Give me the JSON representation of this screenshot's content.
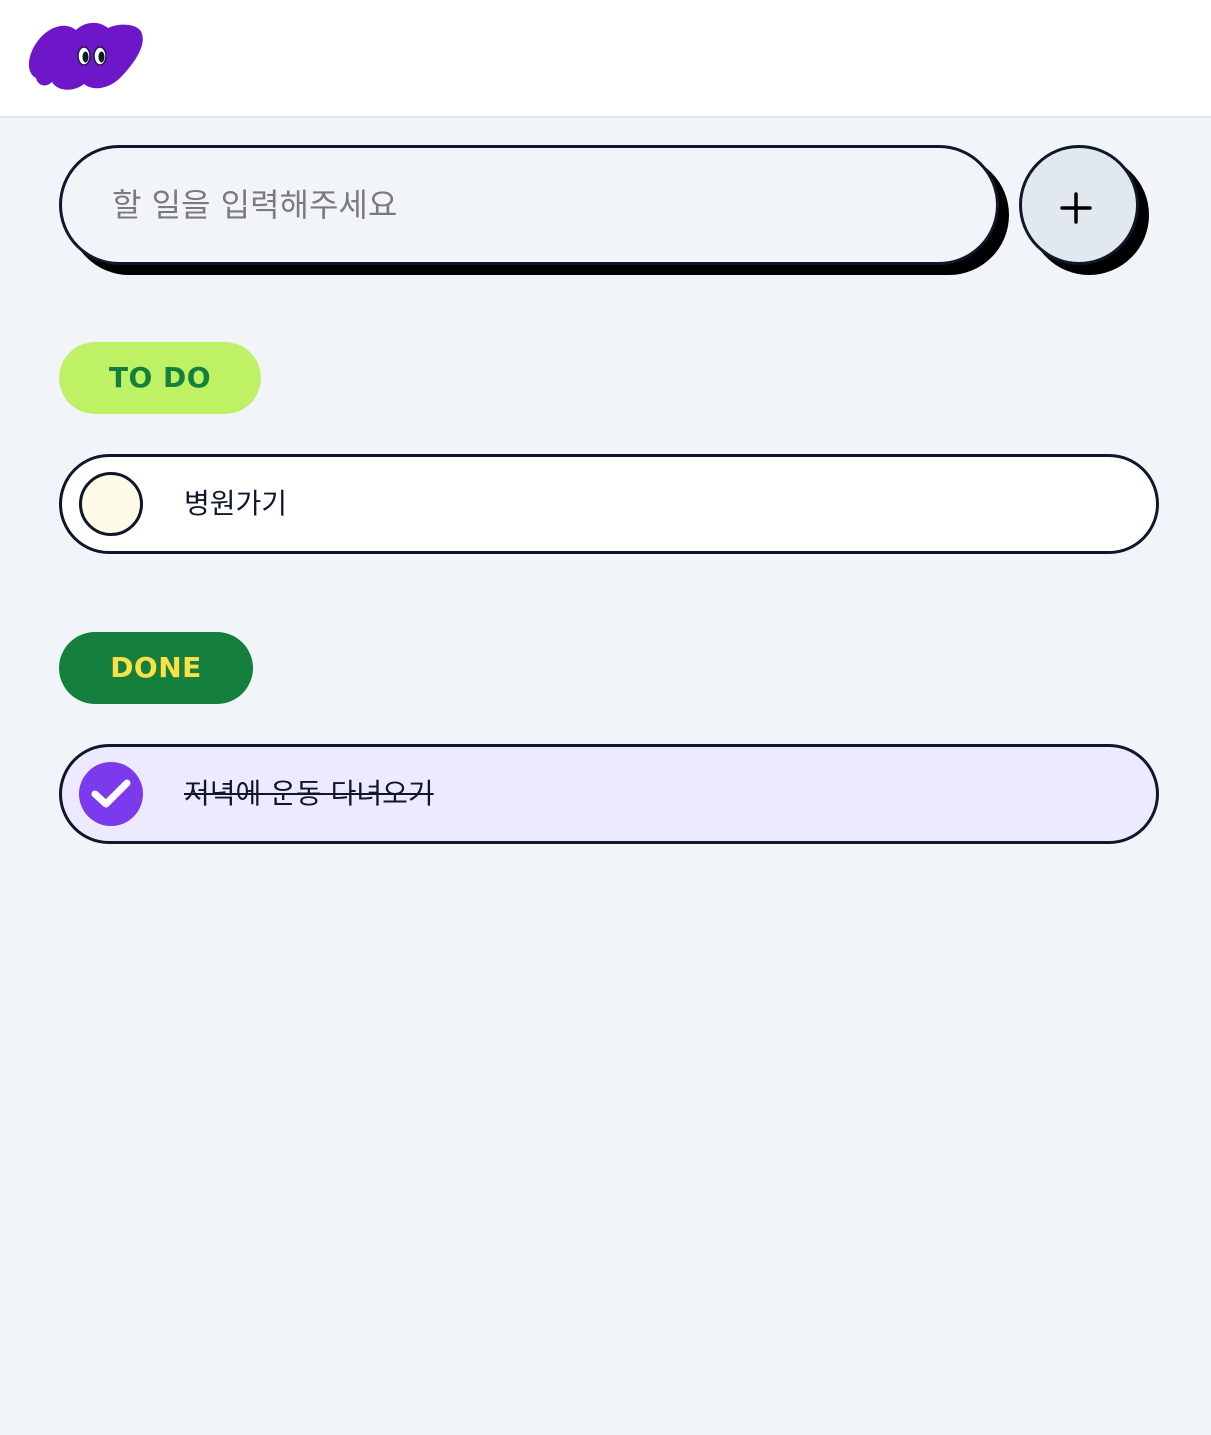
{
  "header": {
    "logo_icon": "purple-blob-mascot-icon"
  },
  "composer": {
    "input_value": "",
    "input_placeholder": "할 일을 입력해주세요",
    "add_button_icon": "plus-icon"
  },
  "sections": {
    "todo": {
      "label": "TO DO",
      "items": [
        {
          "text": "병원가기",
          "done": false
        }
      ]
    },
    "done": {
      "label": "DONE",
      "items": [
        {
          "text": "저녁에 운동 다녀오기",
          "done": true
        }
      ]
    }
  },
  "colors": {
    "page_bg": "#f1f5f9",
    "brand_purple": "#6d28d9",
    "todo_pill_bg": "#bef264",
    "todo_pill_text": "#15803d",
    "done_pill_bg": "#15803d",
    "done_pill_text": "#fde047",
    "done_item_bg": "#ede9fe",
    "check_filled": "#7c3aed"
  }
}
